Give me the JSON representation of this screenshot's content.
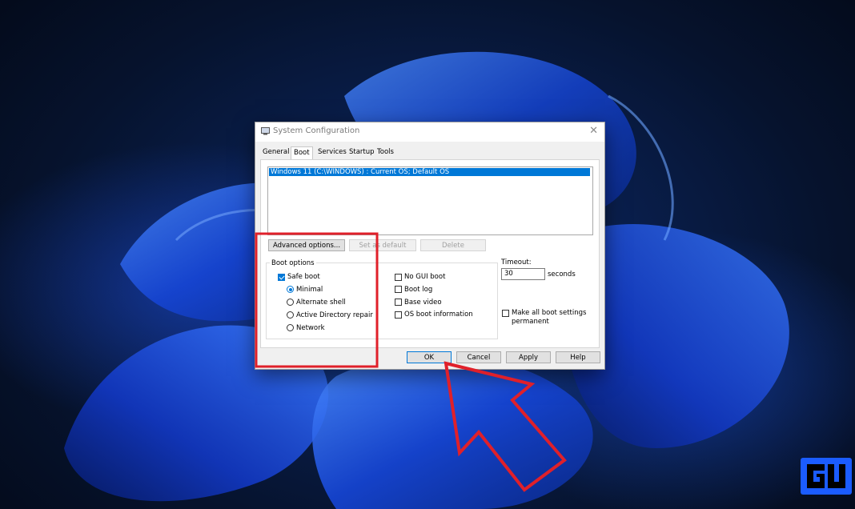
{
  "dialog": {
    "title": "System Configuration",
    "close_glyph": "✕",
    "tabs": [
      "General",
      "Boot",
      "Services",
      "Startup",
      "Tools"
    ],
    "active_tab": "Boot",
    "os_entry": "Windows 11 (C:\\WINDOWS) : Current OS; Default OS",
    "buttons": {
      "advanced": "Advanced options...",
      "set_default": "Set as default",
      "delete": "Delete"
    },
    "boot_options": {
      "label": "Boot options",
      "safe_boot": {
        "label": "Safe boot",
        "checked": true
      },
      "radios": [
        {
          "label": "Minimal",
          "selected": true
        },
        {
          "label": "Alternate shell",
          "selected": false
        },
        {
          "label": "Active Directory repair",
          "selected": false
        },
        {
          "label": "Network",
          "selected": false
        }
      ],
      "checks": [
        {
          "label": "No GUI boot",
          "checked": false
        },
        {
          "label": "Boot log",
          "checked": false
        },
        {
          "label": "Base video",
          "checked": false
        },
        {
          "label": "OS boot information",
          "checked": false
        }
      ]
    },
    "timeout": {
      "label": "Timeout:",
      "value": "30",
      "unit": "seconds"
    },
    "make_permanent": {
      "line1": "Make all boot settings",
      "line2": "permanent",
      "checked": false
    },
    "footer": {
      "ok": "OK",
      "cancel": "Cancel",
      "apply": "Apply",
      "help": "Help"
    }
  },
  "colors": {
    "accent": "#0078d7",
    "annotation": "#e0202a",
    "logo": "#1b5cff"
  },
  "icons": {
    "app": "system-config-icon",
    "close": "close-icon",
    "logo": "gadgets-logo"
  }
}
